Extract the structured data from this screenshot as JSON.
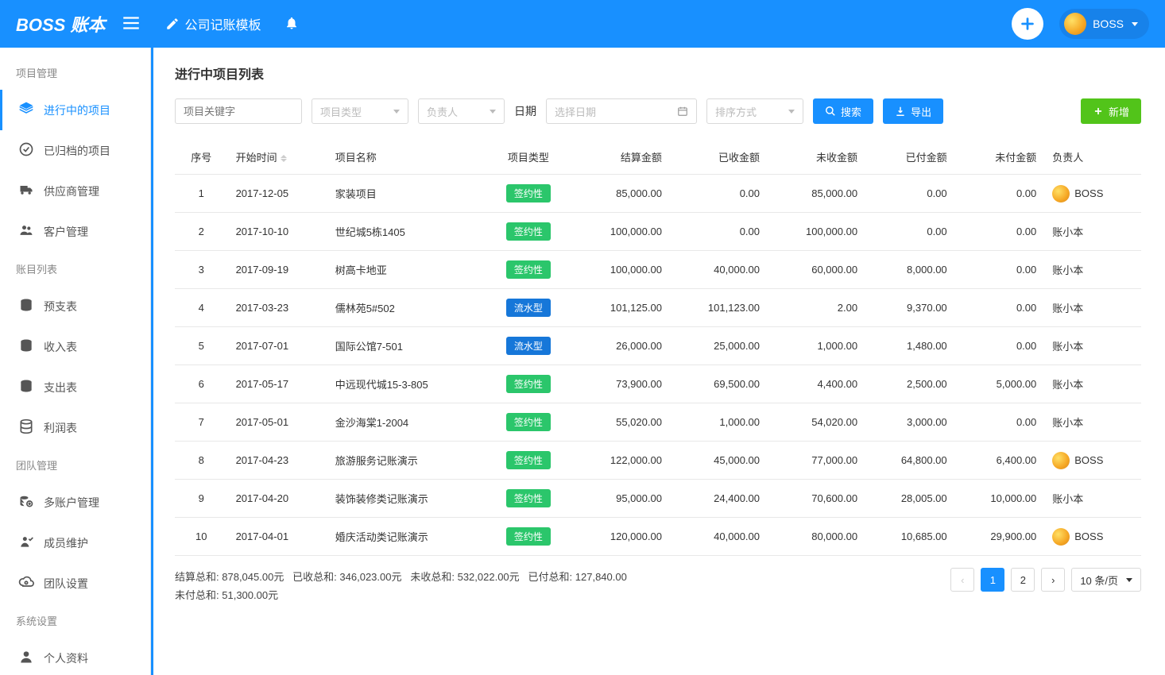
{
  "header": {
    "logo": "BOSS 账本",
    "title": "公司记账模板",
    "userName": "BOSS"
  },
  "sidebar": {
    "groups": [
      {
        "label": "项目管理",
        "items": [
          {
            "key": "in-progress-projects",
            "icon": "layers",
            "label": "进行中的项目",
            "active": true
          },
          {
            "key": "archived-projects",
            "icon": "check-circle",
            "label": "已归档的项目"
          },
          {
            "key": "supplier-management",
            "icon": "truck",
            "label": "供应商管理"
          },
          {
            "key": "customer-management",
            "icon": "users",
            "label": "客户管理"
          }
        ]
      },
      {
        "label": "账目列表",
        "items": [
          {
            "key": "advance-table",
            "icon": "coins",
            "label": "预支表"
          },
          {
            "key": "income-table",
            "icon": "coins",
            "label": "收入表"
          },
          {
            "key": "expense-table",
            "icon": "coins",
            "label": "支出表"
          },
          {
            "key": "profit-table",
            "icon": "db",
            "label": "利润表"
          }
        ]
      },
      {
        "label": "团队管理",
        "items": [
          {
            "key": "multi-account",
            "icon": "accounts",
            "label": "多账户管理"
          },
          {
            "key": "member-maintenance",
            "icon": "member",
            "label": "成员维护"
          },
          {
            "key": "team-settings",
            "icon": "gear-cloud",
            "label": "团队设置"
          }
        ]
      },
      {
        "label": "系统设置",
        "items": [
          {
            "key": "profile",
            "icon": "person",
            "label": "个人资料"
          }
        ]
      }
    ]
  },
  "page": {
    "title": "进行中项目列表"
  },
  "filters": {
    "keywordPlaceholder": "项目关键字",
    "projectType": "项目类型",
    "owner": "负责人",
    "dateLabel": "日期",
    "datePlaceholder": "选择日期",
    "sortBy": "排序方式",
    "searchLabel": "搜索",
    "exportLabel": "导出",
    "addLabel": "新增"
  },
  "table": {
    "headers": {
      "index": "序号",
      "startDate": "开始时间",
      "name": "项目名称",
      "type": "项目类型",
      "settle": "结算金额",
      "received": "已收金额",
      "unreceived": "未收金额",
      "paid": "已付金额",
      "unpaid": "未付金额",
      "owner": "负责人"
    },
    "typeLabels": {
      "sign": "签约性",
      "flow": "流水型"
    },
    "rows": [
      {
        "idx": "1",
        "date": "2017-12-05",
        "name": "家装项目",
        "type": "sign",
        "settle": "85,000.00",
        "received": "0.00",
        "unreceived": "85,000.00",
        "paid": "0.00",
        "unpaid": "0.00",
        "owner": "BOSS",
        "hasAvatar": true
      },
      {
        "idx": "2",
        "date": "2017-10-10",
        "name": "世纪城5栋1405",
        "type": "sign",
        "settle": "100,000.00",
        "received": "0.00",
        "unreceived": "100,000.00",
        "paid": "0.00",
        "unpaid": "0.00",
        "owner": "账小本",
        "hasAvatar": false
      },
      {
        "idx": "3",
        "date": "2017-09-19",
        "name": "树高卡地亚",
        "type": "sign",
        "settle": "100,000.00",
        "received": "40,000.00",
        "unreceived": "60,000.00",
        "paid": "8,000.00",
        "unpaid": "0.00",
        "owner": "账小本",
        "hasAvatar": false
      },
      {
        "idx": "4",
        "date": "2017-03-23",
        "name": "儒林苑5#502",
        "type": "flow",
        "settle": "101,125.00",
        "received": "101,123.00",
        "unreceived": "2.00",
        "paid": "9,370.00",
        "unpaid": "0.00",
        "owner": "账小本",
        "hasAvatar": false
      },
      {
        "idx": "5",
        "date": "2017-07-01",
        "name": "国际公馆7-501",
        "type": "flow",
        "settle": "26,000.00",
        "received": "25,000.00",
        "unreceived": "1,000.00",
        "paid": "1,480.00",
        "unpaid": "0.00",
        "owner": "账小本",
        "hasAvatar": false
      },
      {
        "idx": "6",
        "date": "2017-05-17",
        "name": "中远现代城15-3-805",
        "type": "sign",
        "settle": "73,900.00",
        "received": "69,500.00",
        "unreceived": "4,400.00",
        "paid": "2,500.00",
        "unpaid": "5,000.00",
        "owner": "账小本",
        "hasAvatar": false
      },
      {
        "idx": "7",
        "date": "2017-05-01",
        "name": "金沙海棠1-2004",
        "type": "sign",
        "settle": "55,020.00",
        "received": "1,000.00",
        "unreceived": "54,020.00",
        "paid": "3,000.00",
        "unpaid": "0.00",
        "owner": "账小本",
        "hasAvatar": false
      },
      {
        "idx": "8",
        "date": "2017-04-23",
        "name": "旅游服务记账演示",
        "type": "sign",
        "settle": "122,000.00",
        "received": "45,000.00",
        "unreceived": "77,000.00",
        "paid": "64,800.00",
        "unpaid": "6,400.00",
        "owner": "BOSS",
        "hasAvatar": true
      },
      {
        "idx": "9",
        "date": "2017-04-20",
        "name": "装饰装修类记账演示",
        "type": "sign",
        "settle": "95,000.00",
        "received": "24,400.00",
        "unreceived": "70,600.00",
        "paid": "28,005.00",
        "unpaid": "10,000.00",
        "owner": "账小本",
        "hasAvatar": false
      },
      {
        "idx": "10",
        "date": "2017-04-01",
        "name": "婚庆活动类记账演示",
        "type": "sign",
        "settle": "120,000.00",
        "received": "40,000.00",
        "unreceived": "80,000.00",
        "paid": "10,685.00",
        "unpaid": "29,900.00",
        "owner": "BOSS",
        "hasAvatar": true
      }
    ]
  },
  "totals": {
    "settle": {
      "label": "结算总和:",
      "value": "878,045.00元"
    },
    "received": {
      "label": "已收总和:",
      "value": "346,023.00元"
    },
    "unreceived": {
      "label": "未收总和:",
      "value": "532,022.00元"
    },
    "paid": {
      "label": "已付总和:",
      "value": "127,840.00"
    },
    "unpaid": {
      "label": "未付总和:",
      "value": "51,300.00元"
    }
  },
  "pagination": {
    "pages": [
      "1",
      "2"
    ],
    "current": "1",
    "pageSizeLabel": "10 条/页"
  }
}
